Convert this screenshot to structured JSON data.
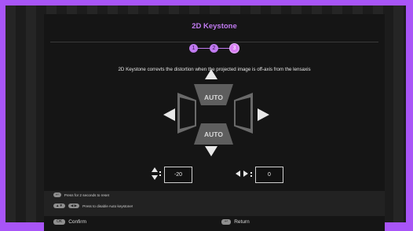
{
  "title": "2D Keystone",
  "steps": [
    "1",
    "2",
    "3"
  ],
  "description": "2D Keystone correvts the distortion when the projected image is off-axis from the lensaxis",
  "auto_top": "AUTO",
  "auto_bottom": "AUTO",
  "vertical_value": "-20",
  "horizontal_value": "0",
  "hints": {
    "reset_key": "↩",
    "reset_text": "Press for 2 seconds to reset",
    "auto_key1": "▲▼",
    "auto_key2": "◀ ▶",
    "auto_text": "Press to disable Auto keystone!"
  },
  "footer": {
    "ok_key": "OK",
    "confirm_label": "Confirm",
    "back_key": "↩",
    "return_label": "Return"
  },
  "colors": {
    "accent": "#c07af0",
    "border": "#a855f7"
  }
}
